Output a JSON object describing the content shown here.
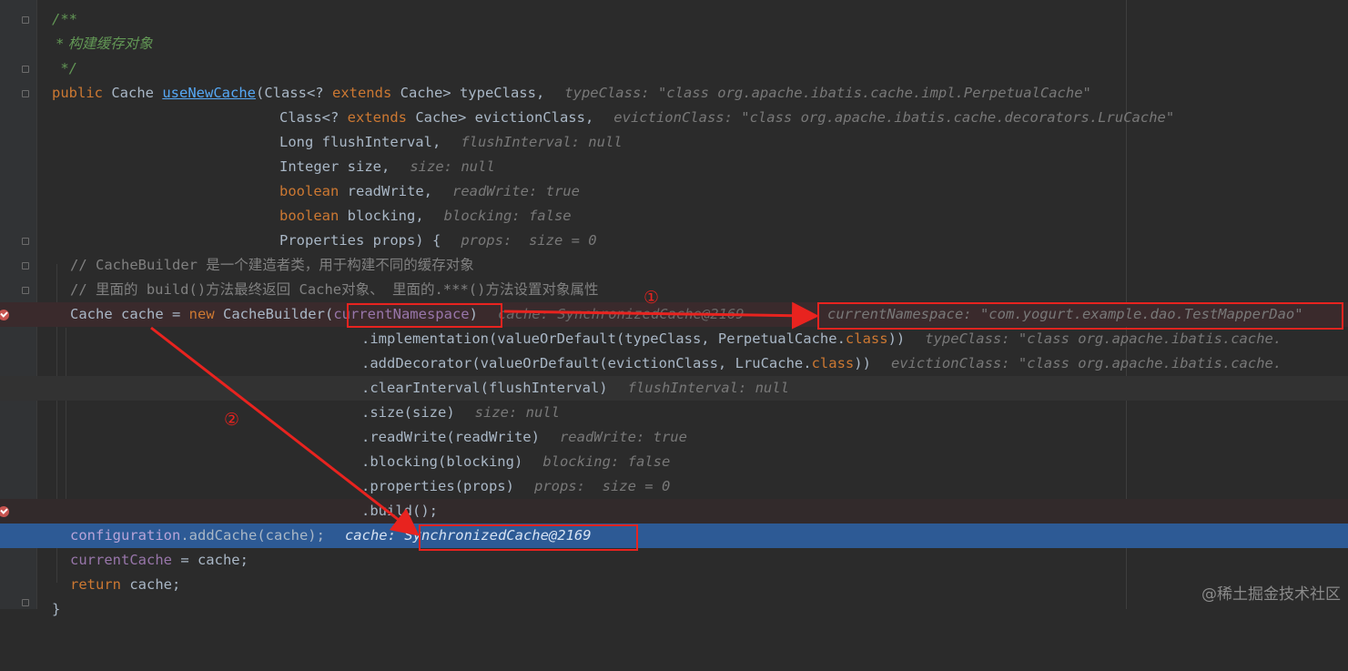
{
  "code": {
    "doc_open": "/**",
    "doc_text": " * 构建缓存对象",
    "doc_close": " */",
    "sig_public": "public",
    "sig_cache": " Cache ",
    "sig_method": "useNewCache",
    "sig_params1a": "(Class<? ",
    "sig_extends": "extends",
    "sig_params1b": " Cache> typeClass,",
    "hint_typeClass": "typeClass: \"class org.apache.ibatis.cache.impl.PerpetualCache\"",
    "p2a": "Class<? ",
    "p2b": " Cache> evictionClass,",
    "hint_evictionClass": "evictionClass: \"class org.apache.ibatis.cache.decorators.LruCache\"",
    "p3": "Long flushInterval,",
    "hint_flushInterval": "flushInterval: null",
    "p4": "Integer size,",
    "hint_size": "size: null",
    "p5_kw": "boolean",
    "p5": " readWrite,",
    "hint_readWrite": "readWrite: true",
    "p6_kw": "boolean",
    "p6": " blocking,",
    "hint_blocking": "blocking: false",
    "p7": "Properties props) {",
    "hint_props": "props:  size = 0",
    "comment1": "// CacheBuilder 是一个建造者类，用于构建不同的缓存对象",
    "comment2": "// 里面的 build()方法最终返回 Cache对象、 里面的.***()方法设置对象属性",
    "cache_decl": "Cache cache = ",
    "kw_new": "new",
    "cache_builder": " CacheBuilder(",
    "current_ns": "currentNamespace",
    "cache_builder_close": ")",
    "hint_cache_obscured": "cache: SynchronizedCache@2169",
    "hint_current_ns": "currentNamespace: \"com.yogurt.example.dao.TestMapperDao\"",
    "impl_a": ".implementation(valueOrDefault(typeClass, PerpetualCache.",
    "kw_class": "class",
    "impl_b": "))",
    "hint_impl": "typeClass: \"class org.apache.ibatis.cache.",
    "dec_a": ".addDecorator(valueOrDefault(evictionClass, LruCache.",
    "dec_b": "))",
    "hint_dec": "evictionClass: \"class org.apache.ibatis.cache.",
    "clear": ".clearInterval(flushInterval)",
    "hint_clear": "flushInterval: null",
    "size_call": ".size(size)",
    "hint_size_call": "size: null",
    "rw_call": ".readWrite(readWrite)",
    "hint_rw_call": "readWrite: true",
    "blk_call": ".blocking(blocking)",
    "hint_blk_call": "blocking: false",
    "props_call": ".properties(props)",
    "hint_props_call": "props:  size = 0",
    "build_call": ".build();",
    "config": "configuration",
    "add_cache": ".addCache(cache);",
    "hint_add_cache_label": "cache: ",
    "hint_add_cache_value": "SynchronizedCache@2169",
    "current_cache": "currentCache",
    "assign_cache": " = cache;",
    "kw_return": "return",
    "return_rest": " cache;",
    "closing": "}"
  },
  "annotations": {
    "marker1": "①",
    "marker2": "②"
  },
  "watermark": "@稀土掘金技术社区",
  "colors": {
    "background": "#2b2b2b",
    "keyword": "#cc7832",
    "execution_line": "#2d5a95",
    "annotation_red": "#e8231f"
  }
}
